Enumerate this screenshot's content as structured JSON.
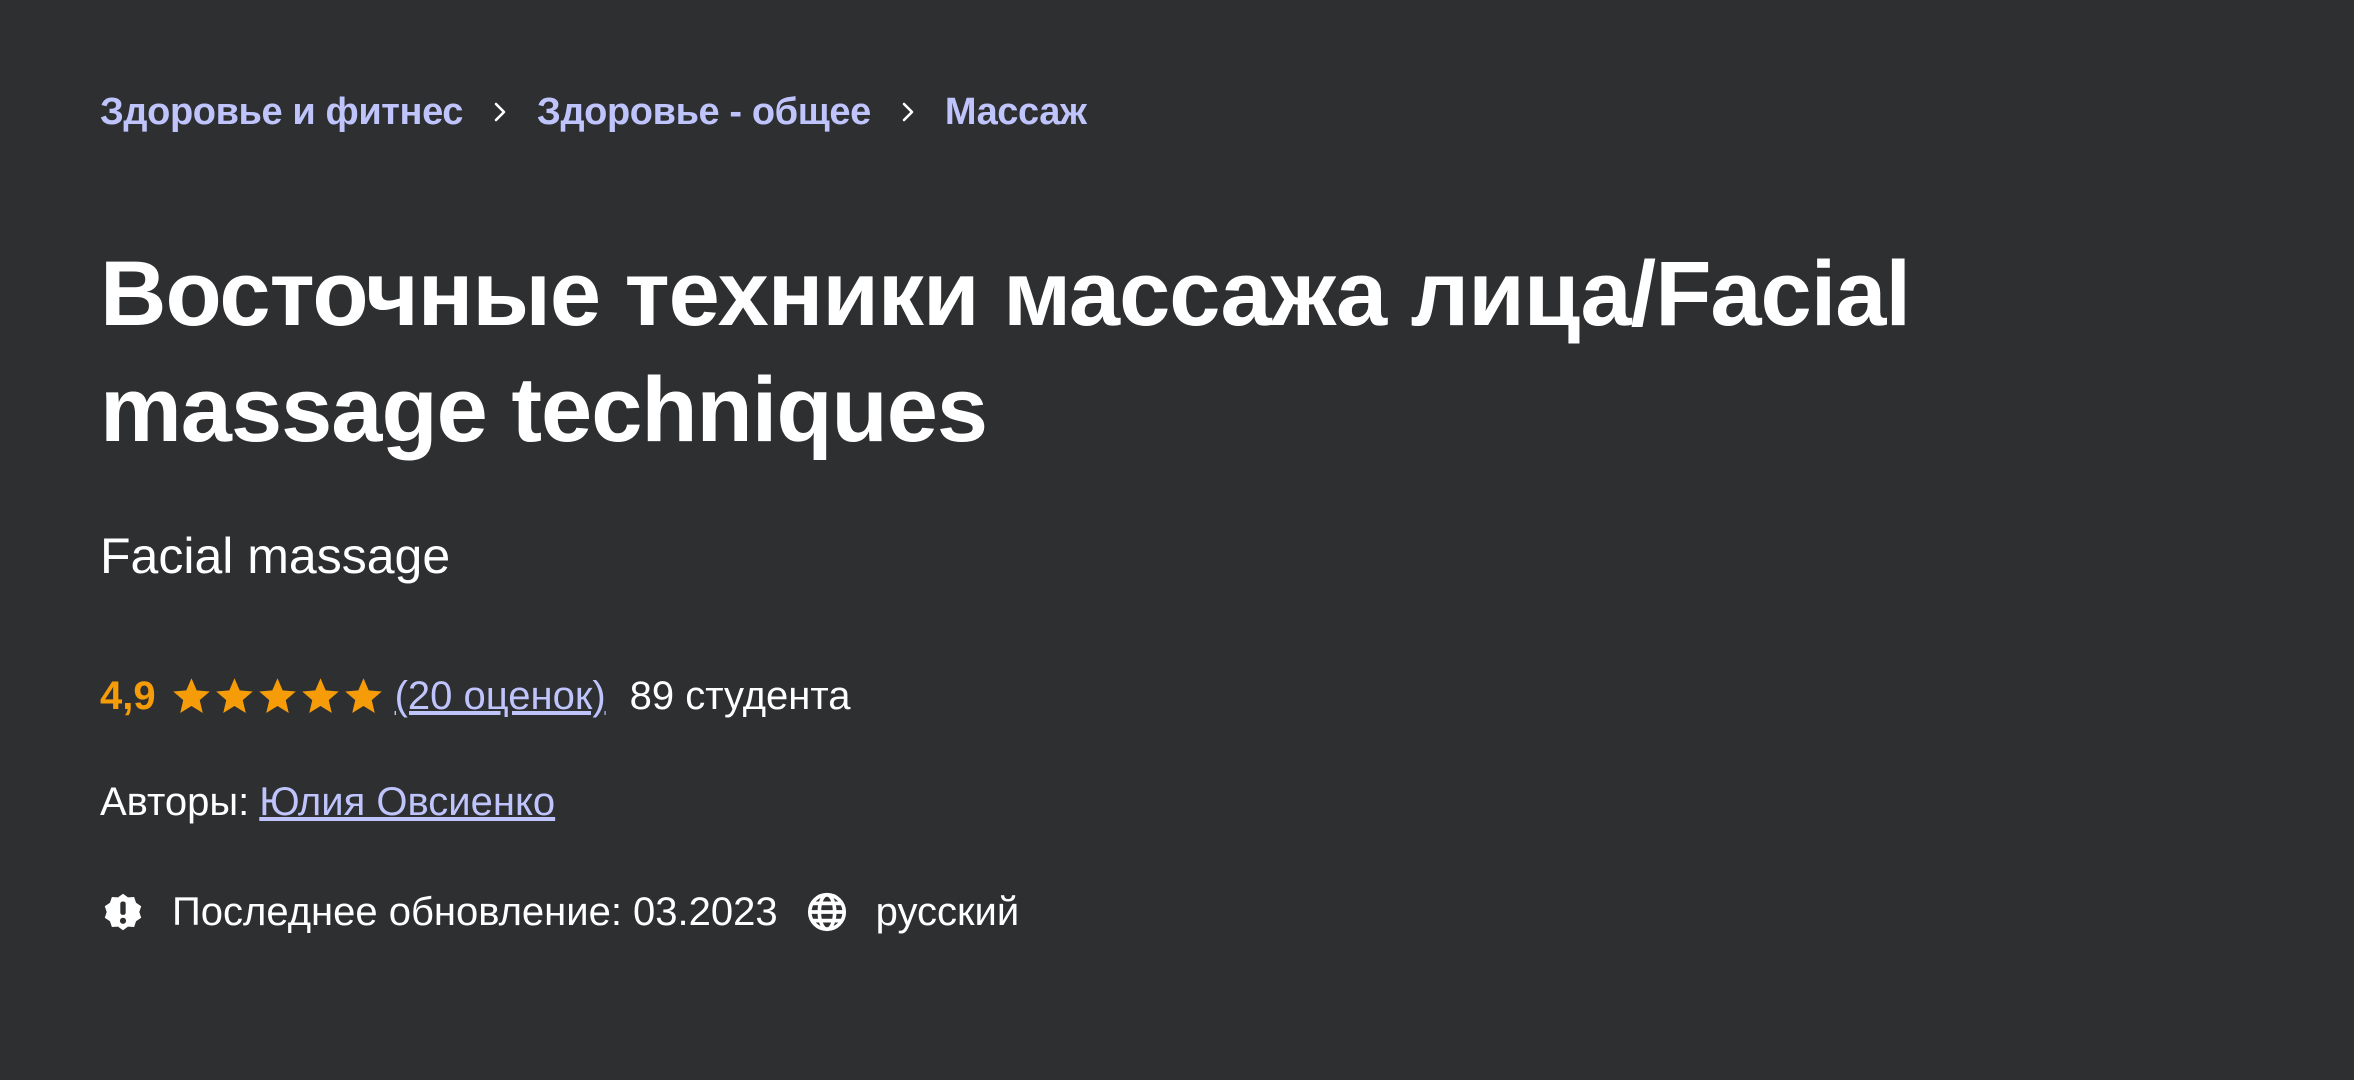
{
  "breadcrumb": {
    "items": [
      {
        "label": "Здоровье и фитнес"
      },
      {
        "label": "Здоровье - общее"
      },
      {
        "label": "Массаж"
      }
    ],
    "separator_icon": "chevron-right-icon"
  },
  "course": {
    "title": "Восточные техники массажа лица/Facial massage techniques",
    "subtitle": "Facial massage"
  },
  "rating": {
    "value": "4,9",
    "stars_filled": 5,
    "stars_total": 5,
    "count_label": "(20 оценок)",
    "students_label": "89 студента"
  },
  "authors": {
    "label": "Авторы:",
    "name": "Юлия Овсиенко"
  },
  "meta": {
    "update_icon": "alert-badge-icon",
    "last_updated": "Последнее обновление: 03.2023",
    "language_icon": "globe-icon",
    "language": "русский"
  },
  "colors": {
    "background": "#2d2f31",
    "link": "#c0c4fc",
    "rating": "#f69c08",
    "text": "#ffffff"
  }
}
